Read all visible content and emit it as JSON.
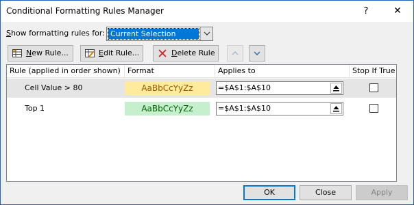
{
  "window": {
    "title": "Conditional Formatting Rules Manager",
    "help_label": "?",
    "close_label": "✕"
  },
  "filter": {
    "label_accel": "S",
    "label_rest": "how formatting rules for:",
    "selected": "Current Selection"
  },
  "toolbar": {
    "new_accel": "N",
    "new_rest": "ew Rule...",
    "edit_accel": "E",
    "edit_rest": "dit Rule...",
    "delete_accel": "D",
    "delete_rest": "elete Rule"
  },
  "grid": {
    "columns": [
      "Rule (applied in order shown)",
      "Format",
      "Applies to",
      "Stop If True"
    ],
    "rows": [
      {
        "rule": "Cell Value > 80",
        "format_preview": "AaBbCcYyZz",
        "applies_to": "=$A$1:$A$10",
        "stop_if_true": false,
        "format_bg": "#ffeb9c",
        "format_fg": "#9c5700"
      },
      {
        "rule": "Top 1",
        "format_preview": "AaBbCcYyZz",
        "applies_to": "=$A$1:$A$10",
        "stop_if_true": false,
        "format_bg": "#c6efce",
        "format_fg": "#006100"
      }
    ]
  },
  "footer": {
    "ok": "OK",
    "close": "Close",
    "apply": "Apply"
  },
  "colors": {
    "accent": "#0078d7",
    "selection_row": "#e5e5e5"
  }
}
